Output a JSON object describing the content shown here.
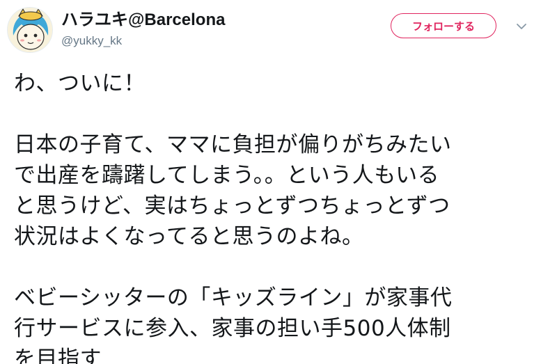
{
  "user": {
    "display_name": "ハラユキ@Barcelona",
    "handle": "@yukky_kk"
  },
  "actions": {
    "follow_label": "フォローする",
    "more_icon": "chevron-down-icon"
  },
  "colors": {
    "accent": "#e0245e",
    "text": "#14171a",
    "muted": "#657786"
  },
  "tweet": {
    "lines": [
      "わ、ついに！",
      "",
      "日本の子育て、ママに負担が偏りがちみたい",
      "で出産を躊躇してしまう。。という人もいる",
      "と思うけど、実はちょっとずつちょっとずつ",
      "状況はよくなってると思うのよね。",
      "",
      "ベビーシッターの「キッズライン」が家事代",
      "行サービスに参入、家事の担い手500人体制",
      "を目指す"
    ]
  }
}
